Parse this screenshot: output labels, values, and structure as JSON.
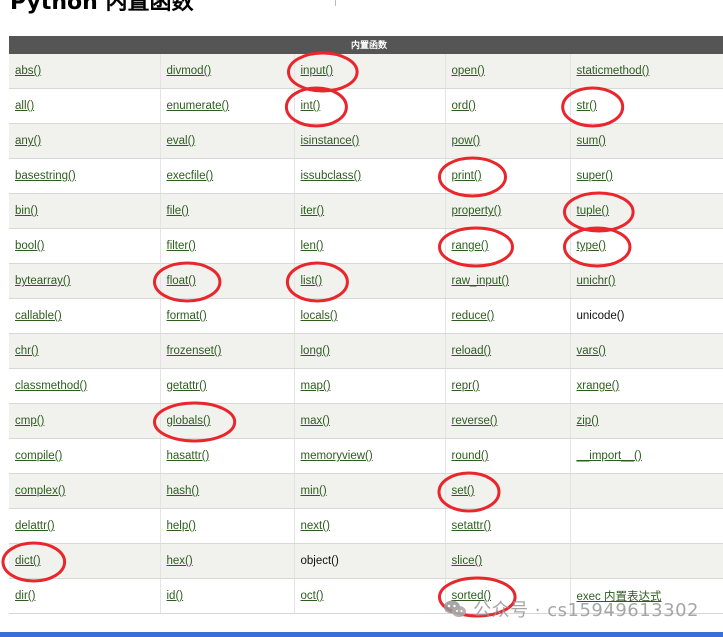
{
  "heading": "Python 内置函数",
  "table": {
    "header": "内置函数",
    "rows": [
      [
        {
          "text": "abs()",
          "link": true
        },
        {
          "text": "divmod()",
          "link": true
        },
        {
          "text": "input()",
          "link": true
        },
        {
          "text": "open()",
          "link": true
        },
        {
          "text": "staticmethod()",
          "link": true
        }
      ],
      [
        {
          "text": "all()",
          "link": true
        },
        {
          "text": "enumerate()",
          "link": true
        },
        {
          "text": "int()",
          "link": true
        },
        {
          "text": "ord()",
          "link": true
        },
        {
          "text": "str()",
          "link": true
        }
      ],
      [
        {
          "text": "any()",
          "link": true
        },
        {
          "text": "eval()",
          "link": true
        },
        {
          "text": "isinstance()",
          "link": true
        },
        {
          "text": "pow()",
          "link": true
        },
        {
          "text": "sum()",
          "link": true
        }
      ],
      [
        {
          "text": "basestring()",
          "link": true
        },
        {
          "text": "execfile()",
          "link": true
        },
        {
          "text": "issubclass()",
          "link": true
        },
        {
          "text": "print()",
          "link": true
        },
        {
          "text": "super()",
          "link": true
        }
      ],
      [
        {
          "text": "bin()",
          "link": true
        },
        {
          "text": "file()",
          "link": true
        },
        {
          "text": "iter()",
          "link": true
        },
        {
          "text": "property()",
          "link": true
        },
        {
          "text": "tuple()",
          "link": true
        }
      ],
      [
        {
          "text": "bool()",
          "link": true
        },
        {
          "text": "filter()",
          "link": true
        },
        {
          "text": "len()",
          "link": true
        },
        {
          "text": "range()",
          "link": true
        },
        {
          "text": "type()",
          "link": true
        }
      ],
      [
        {
          "text": "bytearray()",
          "link": true
        },
        {
          "text": "float()",
          "link": true
        },
        {
          "text": "list()",
          "link": true
        },
        {
          "text": "raw_input()",
          "link": true
        },
        {
          "text": "unichr()",
          "link": true
        }
      ],
      [
        {
          "text": "callable()",
          "link": true
        },
        {
          "text": "format()",
          "link": true
        },
        {
          "text": "locals()",
          "link": true
        },
        {
          "text": "reduce()",
          "link": true
        },
        {
          "text": "unicode()",
          "link": false
        }
      ],
      [
        {
          "text": "chr()",
          "link": true
        },
        {
          "text": "frozenset()",
          "link": true
        },
        {
          "text": "long()",
          "link": true
        },
        {
          "text": "reload()",
          "link": true
        },
        {
          "text": "vars()",
          "link": true
        }
      ],
      [
        {
          "text": "classmethod()",
          "link": true
        },
        {
          "text": "getattr()",
          "link": true
        },
        {
          "text": "map()",
          "link": true
        },
        {
          "text": "repr()",
          "link": true
        },
        {
          "text": "xrange()",
          "link": true
        }
      ],
      [
        {
          "text": "cmp()",
          "link": true
        },
        {
          "text": "globals()",
          "link": true
        },
        {
          "text": "max()",
          "link": true
        },
        {
          "text": "reverse()",
          "link": true
        },
        {
          "text": "zip()",
          "link": true
        }
      ],
      [
        {
          "text": "compile()",
          "link": true
        },
        {
          "text": "hasattr()",
          "link": true
        },
        {
          "text": "memoryview()",
          "link": true
        },
        {
          "text": "round()",
          "link": true
        },
        {
          "text": "__import__()",
          "link": true
        }
      ],
      [
        {
          "text": "complex()",
          "link": true
        },
        {
          "text": "hash()",
          "link": true
        },
        {
          "text": "min()",
          "link": true
        },
        {
          "text": "set()",
          "link": true
        },
        {
          "text": "",
          "link": false
        }
      ],
      [
        {
          "text": "delattr()",
          "link": true
        },
        {
          "text": "help()",
          "link": true
        },
        {
          "text": "next()",
          "link": true
        },
        {
          "text": "setattr()",
          "link": true
        },
        {
          "text": "",
          "link": false
        }
      ],
      [
        {
          "text": "dict()",
          "link": true
        },
        {
          "text": "hex()",
          "link": true
        },
        {
          "text": "object()",
          "link": false
        },
        {
          "text": "slice()",
          "link": true
        },
        {
          "text": "",
          "link": false
        }
      ],
      [
        {
          "text": "dir()",
          "link": true
        },
        {
          "text": "id()",
          "link": true
        },
        {
          "text": "oct()",
          "link": true
        },
        {
          "text": "sorted()",
          "link": true
        },
        {
          "text": "exec 内置表达式",
          "link": true
        }
      ]
    ]
  },
  "circled": [
    "input()",
    "int()",
    "str()",
    "print()",
    "tuple()",
    "range()",
    "type()",
    "float()",
    "list()",
    "globals()",
    "set()",
    "dict()",
    "sorted()"
  ],
  "watermark": {
    "icon": "wechat-icon",
    "text": "公众号 · cs15949613302"
  },
  "colors": {
    "header_bg": "#555555",
    "link": "#2d5c1f",
    "annotation": "#e8262c",
    "bottom_bar": "#3b6fd8"
  }
}
